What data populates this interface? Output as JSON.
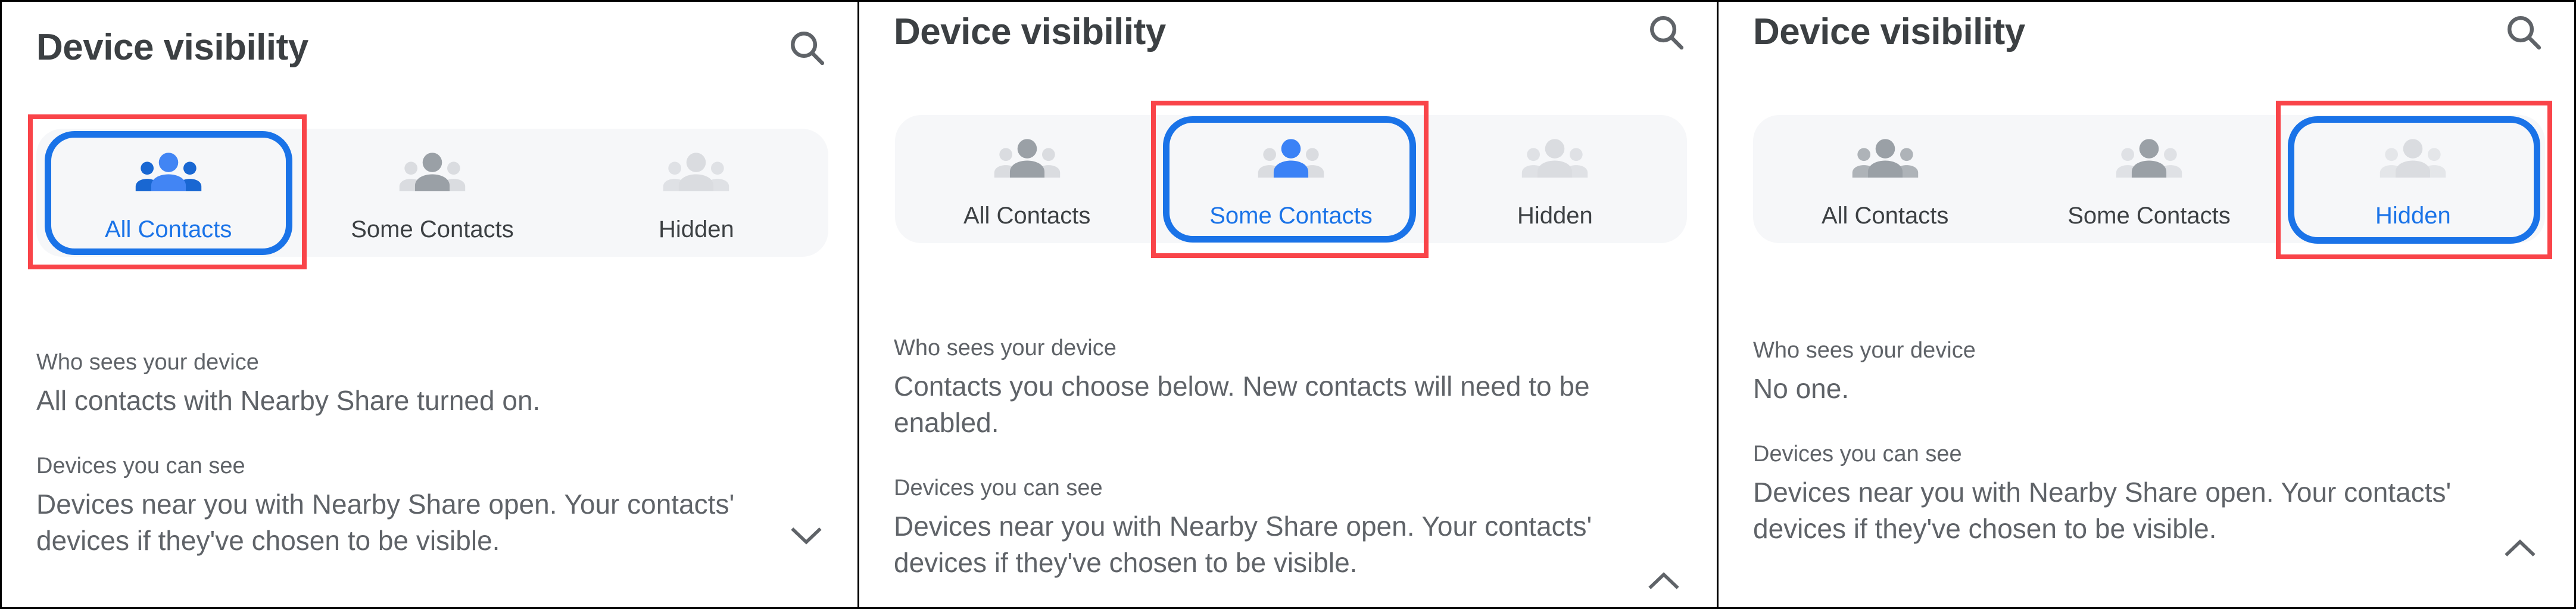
{
  "panels": [
    {
      "id": "panel-all-contacts",
      "header": {
        "title": "Device visibility",
        "search_icon": "search-icon"
      },
      "segmented_control": {
        "options": [
          {
            "label": "All Contacts",
            "icon": "group-people-icon",
            "state": "selected"
          },
          {
            "label": "Some Contacts",
            "icon": "group-people-icon",
            "state": "unselected-mid"
          },
          {
            "label": "Hidden",
            "icon": "group-people-icon",
            "state": "unselected-faint"
          }
        ],
        "selected_index": 0,
        "annotation": "red-highlight-box"
      },
      "details": [
        {
          "label": "Who sees your device",
          "text": "All contacts with Nearby Share turned on."
        },
        {
          "label": "Devices you can see",
          "text": "Devices near you with Nearby Share open. Your contacts' devices if they've chosen to be visible."
        }
      ],
      "expander": {
        "icon": "chevron-down-icon",
        "direction": "down"
      }
    },
    {
      "id": "panel-some-contacts",
      "header": {
        "title": "Device visibility",
        "search_icon": "search-icon"
      },
      "segmented_control": {
        "options": [
          {
            "label": "All Contacts",
            "icon": "group-people-icon",
            "state": "unselected-mid"
          },
          {
            "label": "Some Contacts",
            "icon": "group-people-icon",
            "state": "selected"
          },
          {
            "label": "Hidden",
            "icon": "group-people-icon",
            "state": "unselected-faint"
          }
        ],
        "selected_index": 1,
        "annotation": "red-highlight-box"
      },
      "details": [
        {
          "label": "Who sees your device",
          "text": "Contacts you choose below. New contacts will need to be enabled."
        },
        {
          "label": "Devices you can see",
          "text": "Devices near you with Nearby Share open. Your contacts' devices if they've chosen to be visible."
        }
      ],
      "expander": {
        "icon": "chevron-up-icon",
        "direction": "up"
      }
    },
    {
      "id": "panel-hidden",
      "header": {
        "title": "Device visibility",
        "search_icon": "search-icon"
      },
      "segmented_control": {
        "options": [
          {
            "label": "All Contacts",
            "icon": "group-people-icon",
            "state": "unselected-mid"
          },
          {
            "label": "Some Contacts",
            "icon": "group-people-icon",
            "state": "unselected-faint-mid"
          },
          {
            "label": "Hidden",
            "icon": "group-people-icon",
            "state": "selected-faint"
          }
        ],
        "selected_index": 2,
        "annotation": "red-highlight-box"
      },
      "details": [
        {
          "label": "Who sees your device",
          "text": "No one."
        },
        {
          "label": "Devices you can see",
          "text": "Devices near you with Nearby Share open. Your contacts' devices if they've chosen to be visible."
        }
      ],
      "expander": {
        "icon": "chevron-up-icon",
        "direction": "up"
      }
    }
  ],
  "colors": {
    "accent_blue": "#1a73e8",
    "annotation_red": "#f94449",
    "title_text": "#3c4043",
    "body_text": "#5f6368",
    "segment_bg": "#f6f7f9",
    "icon_dark_gray": "#9aa0a6",
    "icon_light_gray": "#dadce0",
    "icon_blue_light": "#4285f4",
    "icon_blue_dark": "#1967d2",
    "panel_border": "#000000"
  }
}
